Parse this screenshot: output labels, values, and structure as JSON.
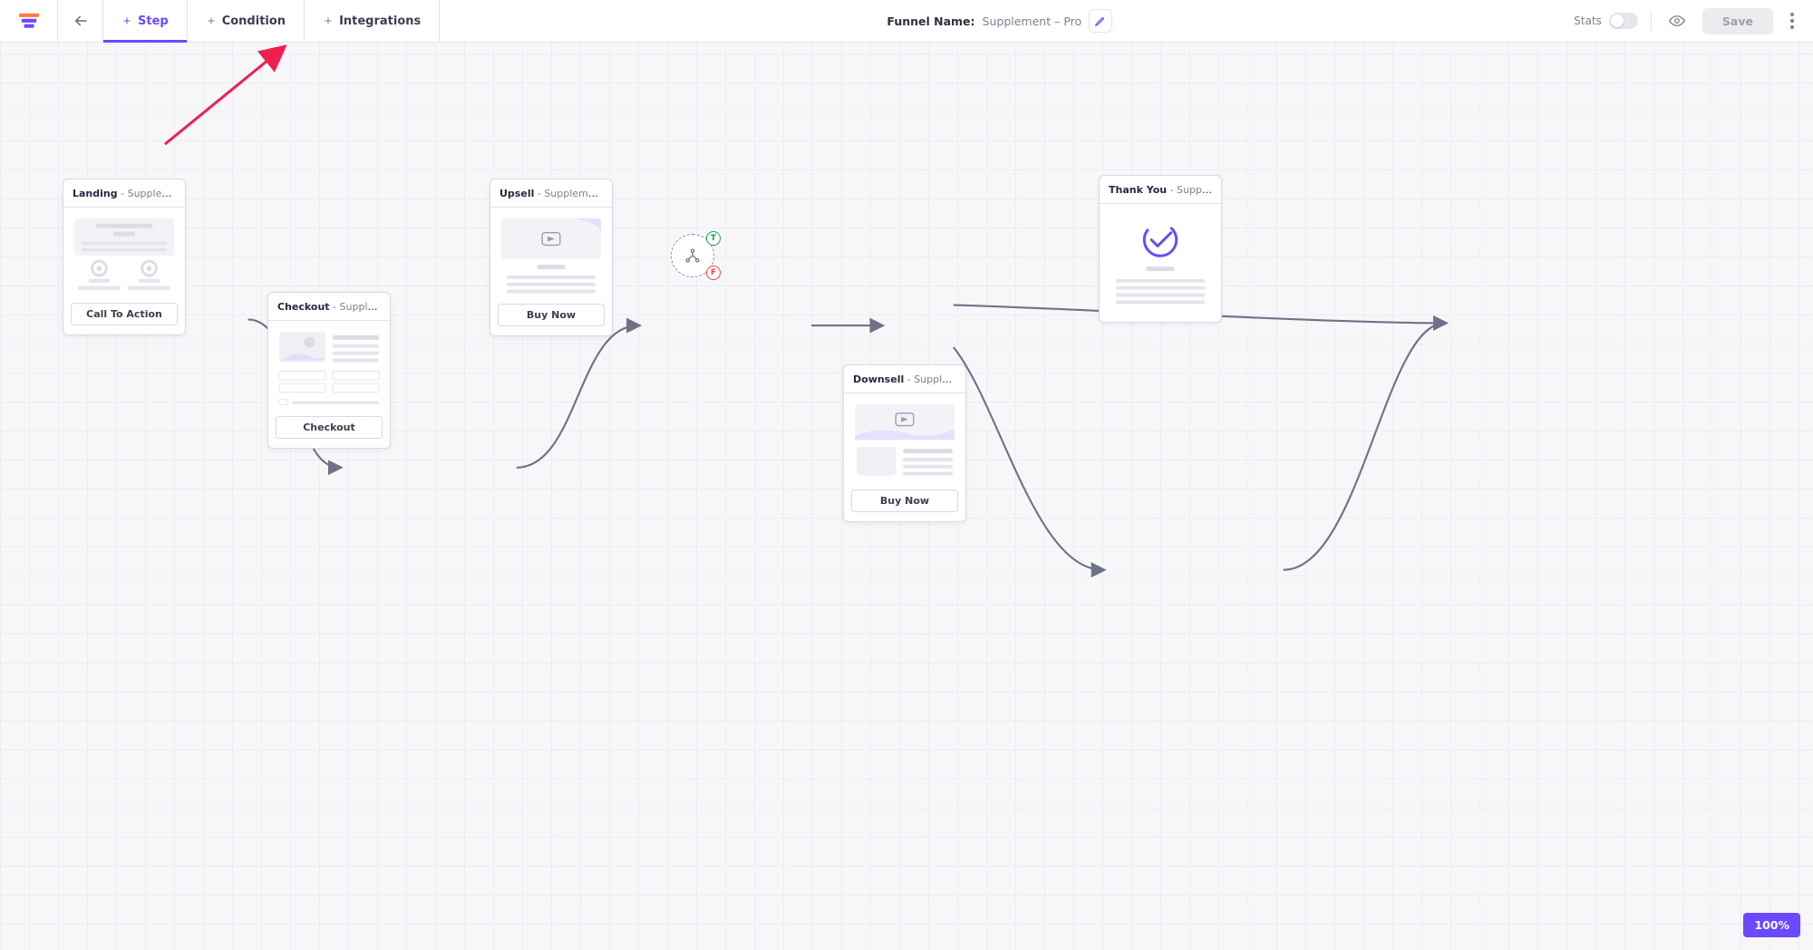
{
  "toolbar": {
    "back_label": "Back",
    "tabs": [
      {
        "label": "Step"
      },
      {
        "label": "Condition"
      },
      {
        "label": "Integrations"
      }
    ],
    "funnel_name_label": "Funnel Name:",
    "funnel_name_value": "Supplement – Pro",
    "stats_label": "Stats",
    "save_label": "Save"
  },
  "condition": {
    "true_badge": "T",
    "false_badge": "F"
  },
  "nodes": {
    "landing": {
      "title": "Landing",
      "subtitle": " - Supplement La...",
      "button": "Call To Action"
    },
    "checkout": {
      "title": "Checkout",
      "subtitle": " - Supplement C...",
      "button": "Checkout"
    },
    "upsell": {
      "title": "Upsell",
      "subtitle": " - Supplement U...",
      "button": "Buy Now"
    },
    "downsell": {
      "title": "Downsell",
      "subtitle": " - Supplement D...",
      "button": "Buy Now"
    },
    "thankyou": {
      "title": "Thank You",
      "subtitle": " - Supplement T..."
    }
  },
  "zoom": {
    "value": "100%"
  }
}
